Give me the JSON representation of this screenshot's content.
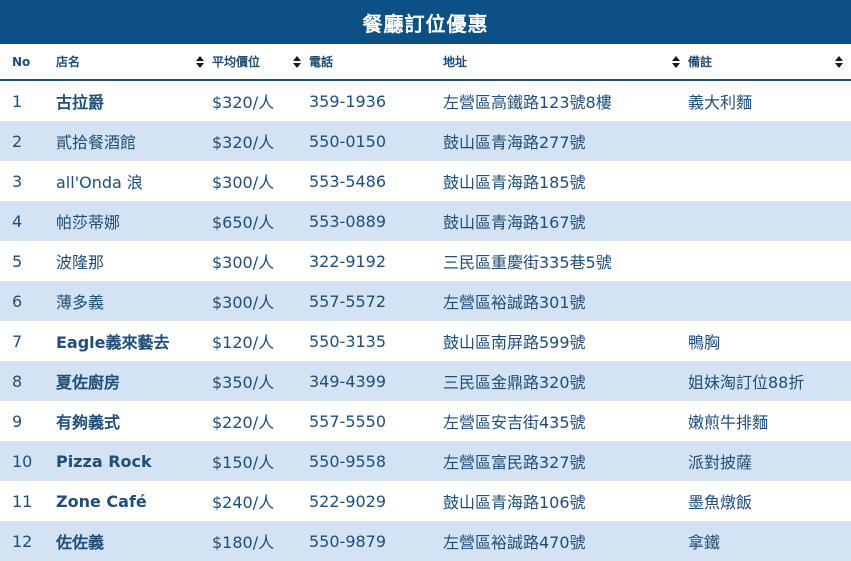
{
  "title": "餐廳訂位優惠",
  "columns": [
    {
      "key": "no",
      "label": "No"
    },
    {
      "key": "name",
      "label": "店名"
    },
    {
      "key": "price",
      "label": "平均價位"
    },
    {
      "key": "phone",
      "label": "電話"
    },
    {
      "key": "address",
      "label": "地址"
    },
    {
      "key": "note",
      "label": "備註"
    }
  ],
  "rows": [
    {
      "no": "1",
      "name": "古拉爵",
      "bold": true,
      "price": "$320/人",
      "phone": "359-1936",
      "address": "左營區高鐵路123號8樓",
      "note": "義大利麵"
    },
    {
      "no": "2",
      "name": "貳拾餐酒館",
      "bold": false,
      "price": "$320/人",
      "phone": "550-0150",
      "address": "鼓山區青海路277號",
      "note": ""
    },
    {
      "no": "3",
      "name": "all'Onda 浪",
      "bold": false,
      "price": "$300/人",
      "phone": "553-5486",
      "address": "鼓山區青海路185號",
      "note": ""
    },
    {
      "no": "4",
      "name": "帕莎蒂娜",
      "bold": false,
      "price": "$650/人",
      "phone": "553-0889",
      "address": "鼓山區青海路167號",
      "note": ""
    },
    {
      "no": "5",
      "name": "波隆那",
      "bold": false,
      "price": "$300/人",
      "phone": "322-9192",
      "address": "三民區重慶街335巷5號",
      "note": ""
    },
    {
      "no": "6",
      "name": "薄多義",
      "bold": false,
      "price": "$300/人",
      "phone": "557-5572",
      "address": "左營區裕誠路301號",
      "note": ""
    },
    {
      "no": "7",
      "name": "Eagle義來藝去",
      "bold": true,
      "price": "$120/人",
      "phone": "550-3135",
      "address": "鼓山區南屏路599號",
      "note": "鴨胸"
    },
    {
      "no": "8",
      "name": "夏佐廚房",
      "bold": true,
      "price": "$350/人",
      "phone": "349-4399",
      "address": "三民區金鼎路320號",
      "note": "姐妹淘訂位88折"
    },
    {
      "no": "9",
      "name": "有夠義式",
      "bold": true,
      "price": "$220/人",
      "phone": "557-5550",
      "address": "左營區安吉街435號",
      "note": "嫩煎牛排麵"
    },
    {
      "no": "10",
      "name": "Pizza Rock",
      "bold": true,
      "price": "$150/人",
      "phone": "550-9558",
      "address": "左營區富民路327號",
      "note": "派對披薩"
    },
    {
      "no": "11",
      "name": "Zone Café",
      "bold": true,
      "price": "$240/人",
      "phone": "522-9029",
      "address": "鼓山區青海路106號",
      "note": "墨魚燉飯"
    },
    {
      "no": "12",
      "name": "佐佐義",
      "bold": true,
      "price": "$180/人",
      "phone": "550-9879",
      "address": "左營區裕誠路470號",
      "note": "拿鐵"
    }
  ],
  "sortable_columns": [
    "name",
    "price",
    "address",
    "note"
  ],
  "colors": {
    "header_bg": "#0d5085",
    "stripe": "#d3e3f3",
    "text": "#1f4e79"
  }
}
